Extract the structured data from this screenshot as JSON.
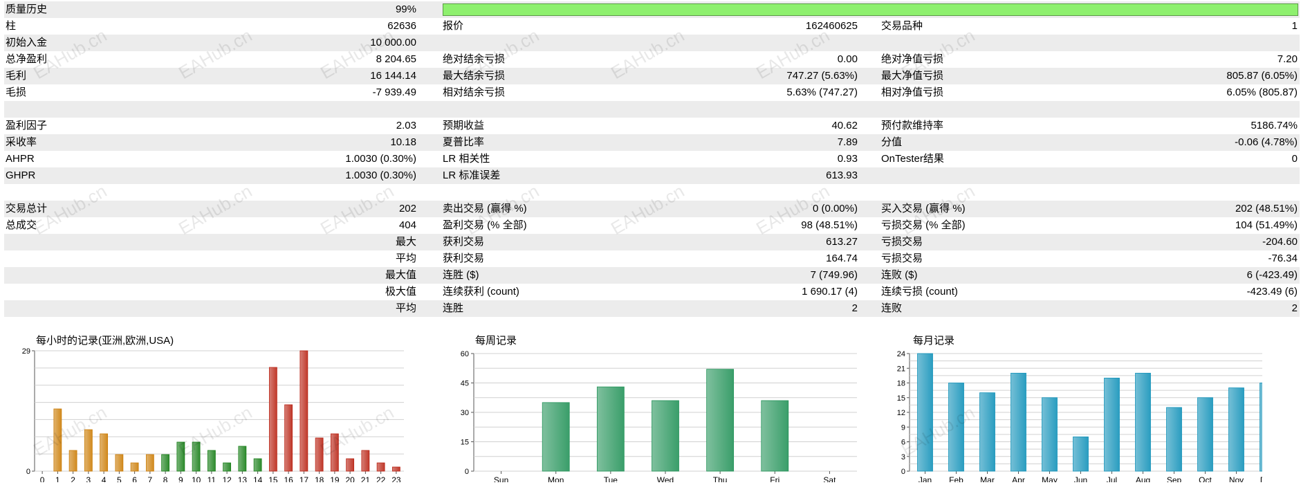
{
  "quality": {
    "label": "质量历史",
    "value": "99%",
    "percent": 99
  },
  "rows": [
    {
      "label1": "柱",
      "value1": "62636",
      "label2": "报价",
      "value2": "162460625",
      "label3": "交易品种",
      "value3": "1"
    },
    {
      "label1": "初始入金",
      "value1": "10 000.00",
      "label2": "",
      "value2": "",
      "label3": "",
      "value3": ""
    },
    {
      "label1": "总净盈利",
      "value1": "8 204.65",
      "label2": "绝对结余亏损",
      "value2": "0.00",
      "label3": "绝对净值亏损",
      "value3": "7.20"
    },
    {
      "label1": "毛利",
      "value1": "16 144.14",
      "label2": "最大结余亏损",
      "value2": "747.27 (5.63%)",
      "label3": "最大净值亏损",
      "value3": "805.87 (6.05%)"
    },
    {
      "label1": "毛损",
      "value1": "-7 939.49",
      "label2": "相对结余亏损",
      "value2": "5.63% (747.27)",
      "label3": "相对净值亏损",
      "value3": "6.05% (805.87)"
    },
    {
      "label1": "",
      "value1": "",
      "label2": "",
      "value2": "",
      "label3": "",
      "value3": ""
    },
    {
      "label1": "盈利因子",
      "value1": "2.03",
      "label2": "预期收益",
      "value2": "40.62",
      "label3": "预付款维持率",
      "value3": "5186.74%"
    },
    {
      "label1": "采收率",
      "value1": "10.18",
      "label2": "夏普比率",
      "value2": "7.89",
      "label3": "分值",
      "value3": "-0.06 (4.78%)"
    },
    {
      "label1": "AHPR",
      "value1": "1.0030 (0.30%)",
      "label2": "LR 相关性",
      "value2": "0.93",
      "label3": "OnTester结果",
      "value3": "0"
    },
    {
      "label1": "GHPR",
      "value1": "1.0030 (0.30%)",
      "label2": "LR 标准误差",
      "value2": "613.93",
      "label3": "",
      "value3": ""
    },
    {
      "label1": "",
      "value1": "",
      "label2": "",
      "value2": "",
      "label3": "",
      "value3": ""
    },
    {
      "label1": "交易总计",
      "value1": "202",
      "label2": "卖出交易 (赢得 %)",
      "value2": "0 (0.00%)",
      "label3": "买入交易 (赢得 %)",
      "value3": "202 (48.51%)"
    },
    {
      "label1": "总成交",
      "value1": "404",
      "label2": "盈利交易 (% 全部)",
      "value2": "98 (48.51%)",
      "label3": "亏损交易 (% 全部)",
      "value3": "104 (51.49%)"
    },
    {
      "label1": "",
      "value1": "最大",
      "label2": "获利交易",
      "value2": "613.27",
      "label3": "亏损交易",
      "value3": "-204.60"
    },
    {
      "label1": "",
      "value1": "平均",
      "label2": "获利交易",
      "value2": "164.74",
      "label3": "亏损交易",
      "value3": "-76.34"
    },
    {
      "label1": "",
      "value1": "最大值",
      "label2": "连胜 ($)",
      "value2": "7 (749.96)",
      "label3": "连败 ($)",
      "value3": "6 (-423.49)"
    },
    {
      "label1": "",
      "value1": "极大值",
      "label2": "连续获利 (count)",
      "value2": "1 690.17 (4)",
      "label3": "连续亏损 (count)",
      "value3": "-423.49 (6)"
    },
    {
      "label1": "",
      "value1": "平均",
      "label2": "连胜",
      "value2": "2",
      "label3": "连败",
      "value3": "2"
    },
    {
      "label1": "",
      "value1": "",
      "label2": "",
      "value2": "",
      "label3": "",
      "value3": ""
    }
  ],
  "watermark": "EAHub.cn",
  "colors": {
    "quality_bar": "#8ef06e",
    "row_shade": "#ececec",
    "asia": "#d18a1f",
    "europe": "#2e8b2e",
    "usa": "#c0392b",
    "weekly": "#3a9e6a",
    "monthly": "#2a9dc0"
  },
  "chart_data": [
    {
      "type": "bar",
      "title": "每小时的记录(亚洲,欧洲,USA)",
      "categories": [
        "0",
        "1",
        "2",
        "3",
        "4",
        "5",
        "6",
        "7",
        "8",
        "9",
        "10",
        "11",
        "12",
        "13",
        "14",
        "15",
        "16",
        "17",
        "18",
        "19",
        "20",
        "21",
        "22",
        "23"
      ],
      "values": [
        0,
        15,
        5,
        10,
        9,
        4,
        2,
        4,
        4,
        7,
        7,
        5,
        2,
        6,
        3,
        25,
        16,
        29,
        8,
        9,
        3,
        5,
        2,
        1
      ],
      "ylim": [
        0,
        29
      ],
      "yticks": [
        0,
        29
      ],
      "groups": [
        "亚洲",
        "欧洲",
        "USA"
      ]
    },
    {
      "type": "bar",
      "title": "每周记录",
      "categories": [
        "Sun",
        "Mon",
        "Tue",
        "Wed",
        "Thu",
        "Fri",
        "Sat"
      ],
      "values": [
        0,
        35,
        43,
        36,
        52,
        36,
        0
      ],
      "ylim": [
        0,
        60
      ],
      "yticks": [
        0,
        15,
        30,
        45,
        60
      ]
    },
    {
      "type": "bar",
      "title": "每月记录",
      "categories": [
        "Jan",
        "Feb",
        "Mar",
        "Apr",
        "May",
        "Jun",
        "Jul",
        "Aug",
        "Sep",
        "Oct",
        "Nov",
        "Dec"
      ],
      "values": [
        24,
        18,
        16,
        20,
        15,
        7,
        19,
        20,
        13,
        15,
        17,
        18
      ],
      "ylim": [
        0,
        24
      ],
      "yticks": [
        0,
        3,
        6,
        9,
        12,
        15,
        18,
        21,
        24
      ]
    }
  ]
}
